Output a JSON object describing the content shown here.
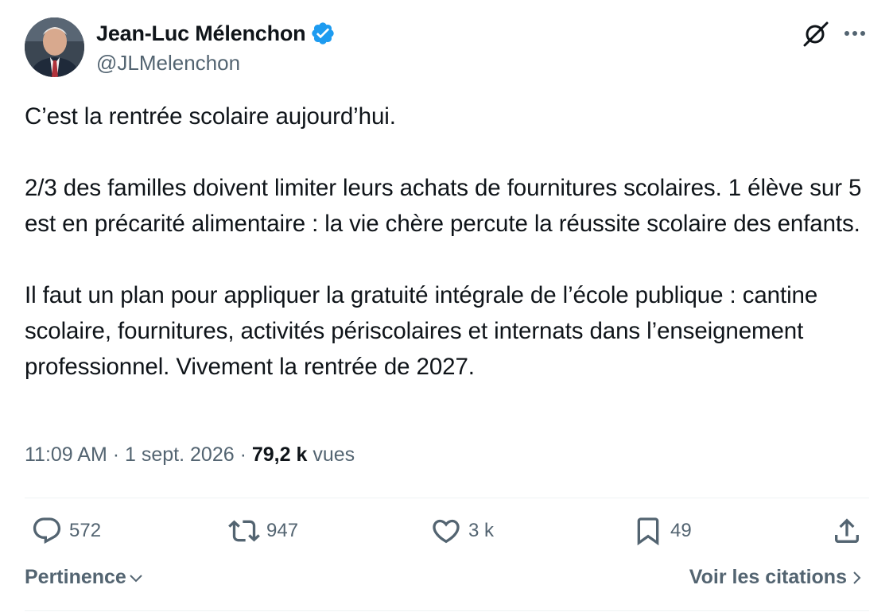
{
  "author": {
    "name": "Jean-Luc Mélenchon",
    "handle": "@JLMelenchon",
    "verified_color": "#1d9bf0",
    "avatar_icon": "avatar-photo"
  },
  "post": {
    "paragraphs": [
      "C’est la rentrée scolaire aujourd’hui.",
      "2/3 des familles doivent limiter leurs achats de fournitures scolaires. 1 élève sur 5 est en précarité alimentaire : la vie chère percute la réussite scolaire des enfants.",
      "Il faut un plan pour appliquer la gratuité intégrale de l’école publique : cantine scolaire, fournitures, activités périscolaires et internats dans l’enseignement professionnel. Vivement la rentrée de 2027."
    ],
    "time": "11:09 AM",
    "separator": "·",
    "date": "1 sept. 2026",
    "views_count": "79,2 k",
    "views_label": "vues"
  },
  "actions": {
    "replies": "572",
    "reposts": "947",
    "likes": "3 k",
    "bookmarks": "49"
  },
  "footer": {
    "sort_label": "Pertinence",
    "quotes_label": "Voir les citations"
  },
  "colors": {
    "text": "#0f1419",
    "secondary": "#536471",
    "divider": "#eff3f4",
    "accent": "#1d9bf0"
  }
}
